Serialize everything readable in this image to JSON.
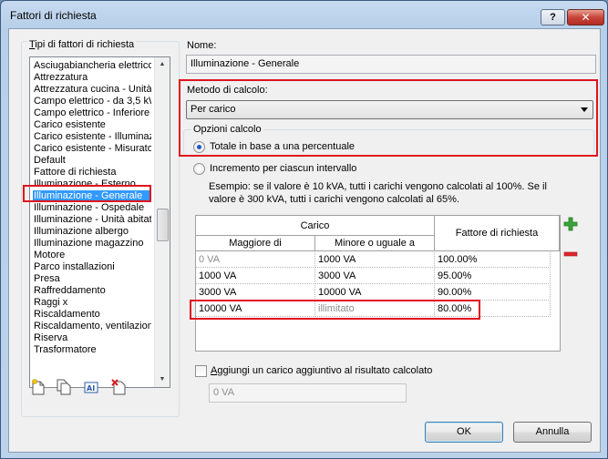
{
  "window": {
    "title": "Fattori di richiesta",
    "help_label": "?",
    "close_label": "✕"
  },
  "left_panel": {
    "group_label": "Tipi di fattori di richiesta",
    "items": [
      "Asciugabiancheria elettrico",
      "Attrezzatura",
      "Attrezzatura cucina - Unità",
      "Campo elettrico - da 3,5 kW",
      "Campo elettrico - Inferiore a",
      "Carico esistente",
      "Carico esistente - Illuminazi",
      "Carico esistente - Misurato",
      "Default",
      "Fattore di richiesta",
      "Illuminazione - Esterno",
      "Illuminazione - Generale",
      "Illuminazione - Ospedale",
      "Illuminazione - Unità abitativ",
      "Illuminazione albergo",
      "Illuminazione magazzino",
      "Motore",
      "Parco installazioni",
      "Presa",
      "Raffreddamento",
      "Raggi x",
      "Riscaldamento",
      "Riscaldamento, ventilazione",
      "Riserva",
      "Trasformatore"
    ],
    "selected_index": 11,
    "tools": [
      "new-icon",
      "duplicate-icon",
      "rename-icon",
      "delete-icon"
    ]
  },
  "right_panel": {
    "name_label": "Nome:",
    "name_value": "Illuminazione - Generale",
    "method_label": "Metodo di calcolo:",
    "method_value": "Per carico",
    "options_label": "Opzioni calcolo",
    "option_total": "Totale in base a una percentuale",
    "option_increment": "Incremento per ciascun intervallo",
    "selected_option": "total",
    "example_text_1": "Esempio: se il valore è 10 kVA, tutti i carichi vengono calcolati al 100%. Se il",
    "example_text_2": "valore è 300 kVA, tutti i carichi vengono calcolati al 65%.",
    "table": {
      "group_header": "Carico",
      "col_greater": "Maggiore di",
      "col_less_equal": "Minore o uguale a",
      "col_factor": "Fattore di richiesta",
      "rows": [
        {
          "greater": "0 VA",
          "less_equal": "1000 VA",
          "factor": "100.00%"
        },
        {
          "greater": "1000 VA",
          "less_equal": "3000 VA",
          "factor": "95.00%"
        },
        {
          "greater": "3000 VA",
          "less_equal": "10000 VA",
          "factor": "90.00%"
        },
        {
          "greater": "10000 VA",
          "less_equal": "illimitato",
          "factor": "80.00%"
        }
      ],
      "add_icon": "plus-icon",
      "remove_icon": "minus-icon",
      "add_color": "#2e9d2e",
      "remove_color": "#e0141e"
    },
    "additional_load_label": "Aggiungi un carico aggiuntivo al risultato calcolato",
    "additional_load_checked": false,
    "additional_load_value": "0 VA"
  },
  "buttons": {
    "ok": "OK",
    "cancel": "Annulla"
  },
  "highlight_color": "#e0141e"
}
